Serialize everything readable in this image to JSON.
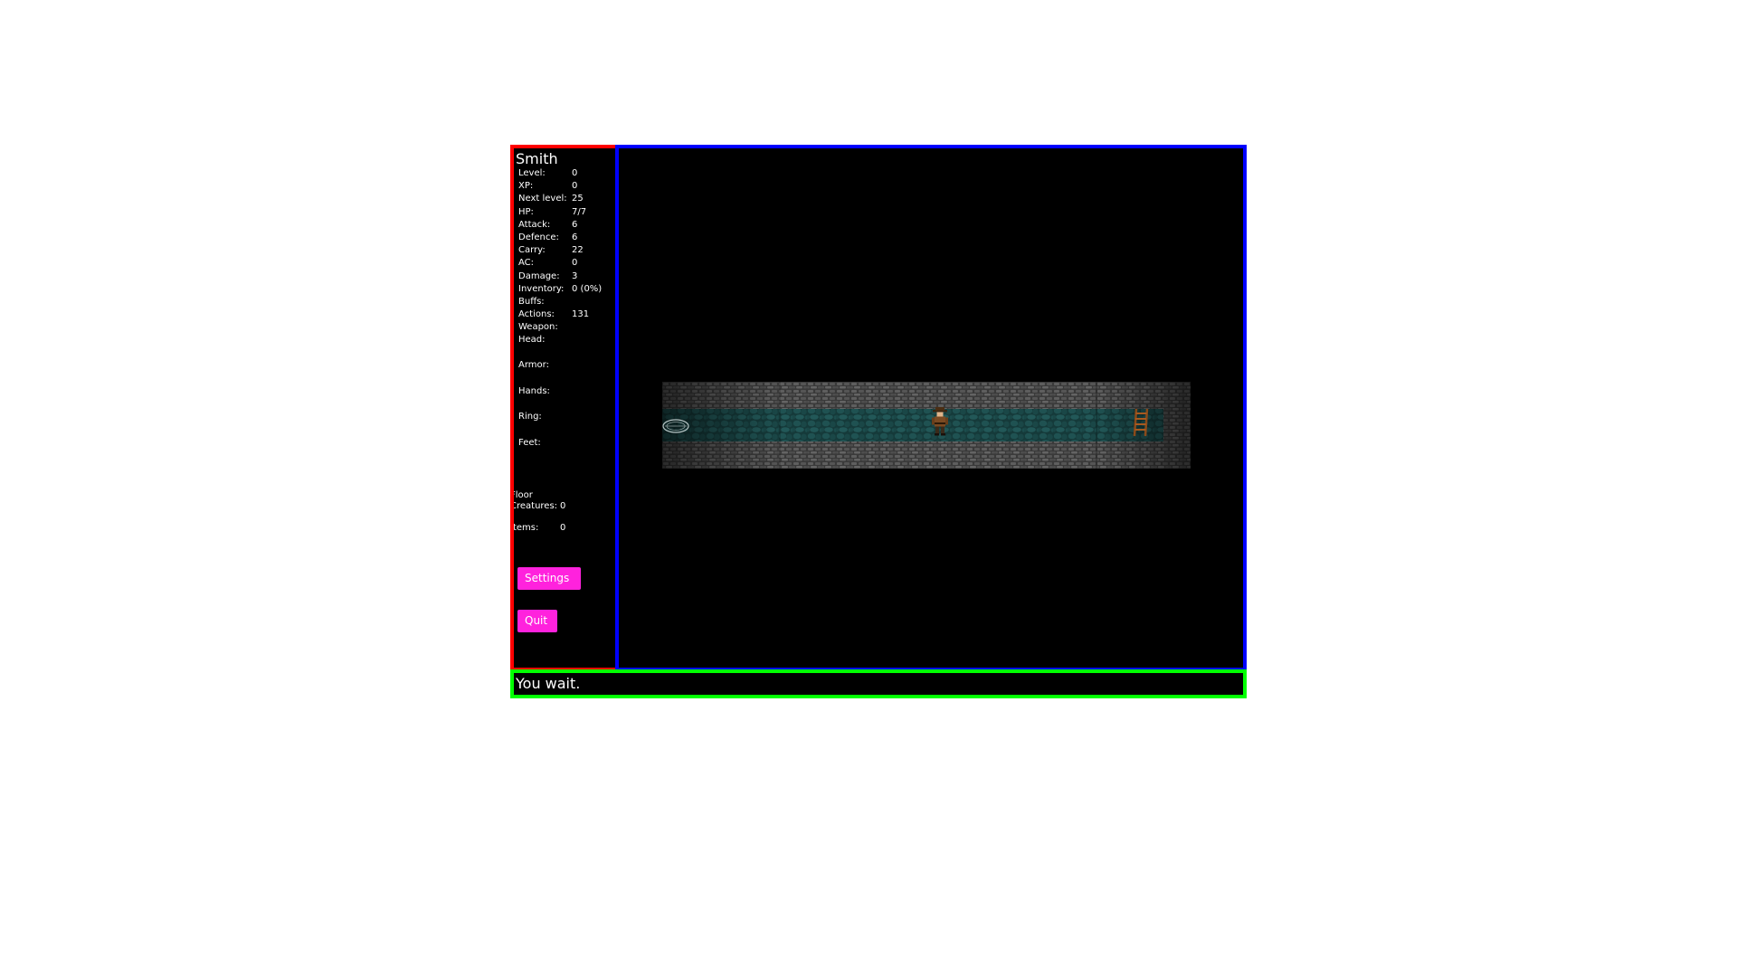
{
  "player": {
    "name": "Smith"
  },
  "stats": [
    {
      "label": "Level:",
      "value": "0"
    },
    {
      "label": "XP:",
      "value": "0"
    },
    {
      "label": "Next level:",
      "value": "25"
    },
    {
      "label": "HP:",
      "value": "7/7"
    },
    {
      "label": "Attack:",
      "value": "6"
    },
    {
      "label": "Defence:",
      "value": "6"
    },
    {
      "label": "Carry:",
      "value": "22"
    },
    {
      "label": "AC:",
      "value": "0"
    },
    {
      "label": "Damage:",
      "value": "3"
    },
    {
      "label": "Inventory:",
      "value": "0 (0%)"
    },
    {
      "label": "Buffs:",
      "value": ""
    },
    {
      "label": "Actions:",
      "value": "131"
    },
    {
      "label": "Weapon:",
      "value": ""
    }
  ],
  "equipment": [
    {
      "label": "Head:"
    },
    {
      "label": "Armor:"
    },
    {
      "label": "Hands:"
    },
    {
      "label": "Ring:"
    },
    {
      "label": "Feet:"
    }
  ],
  "floor": {
    "title": "Floor",
    "creatures_label": "Creatures:",
    "creatures_value": "0",
    "items_label": "Items:",
    "items_value": "0"
  },
  "buttons": {
    "settings": "Settings",
    "quit": "Quit"
  },
  "message": "You wait.",
  "map": {
    "tiles": [
      "wall",
      "floor",
      "trap",
      "player",
      "ladder"
    ],
    "player_icon": "adventurer-icon",
    "trap_icon": "pressure-plate-icon",
    "stairs_icon": "ladder-icon"
  },
  "colors": {
    "stats_border": "#ff0000",
    "map_border": "#0000ff",
    "message_border": "#00ff00",
    "button_bg": "#ff22dd",
    "wall": "#4a4a4a",
    "floor": "#1c4a4a"
  }
}
